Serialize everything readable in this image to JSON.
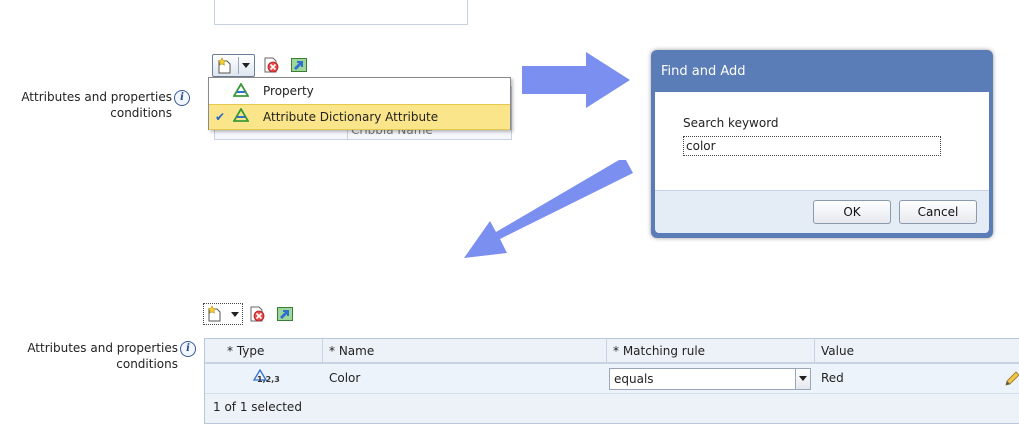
{
  "step1": {
    "label_line1": "Attributes and properties",
    "label_line2": "conditions",
    "menu": {
      "items": [
        {
          "label": "Property",
          "checked": false,
          "selected": false
        },
        {
          "label": "Attribute Dictionary Attribute",
          "checked": true,
          "selected": true
        }
      ],
      "obscured_text": "Cribbia Name"
    }
  },
  "dialog": {
    "title": "Find and Add",
    "search_label": "Search keyword",
    "search_value": "color",
    "ok_label": "OK",
    "cancel_label": "Cancel"
  },
  "step3": {
    "label_line1": "Attributes and properties",
    "label_line2": "conditions",
    "table": {
      "columns": [
        "* Type",
        "* Name",
        "* Matching rule",
        "Value"
      ],
      "rows": [
        {
          "type_icon_text": "1,2,3",
          "name": "Color",
          "matching_rule": "equals",
          "value": "Red"
        }
      ],
      "footer": "1 of 1 selected"
    }
  },
  "colors": {
    "arrow": "#7b8ff0",
    "dialog_frame": "#5a7db8",
    "menu_selected": "#fbe58a"
  }
}
